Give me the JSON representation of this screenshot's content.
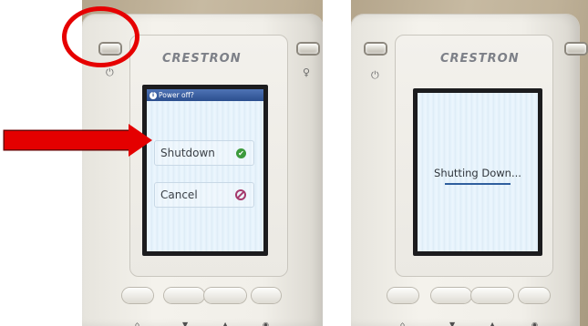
{
  "left_panel": {
    "brand": "CRESTRON",
    "dialog_title": "Power off?",
    "option_shutdown": "Shutdown",
    "option_cancel": "Cancel"
  },
  "right_panel": {
    "brand": "CRESTRON",
    "status_text": "Shutting Down..."
  },
  "icons": [
    "power-icon",
    "lightbulb-icon",
    "home-icon",
    "down-arrow-icon",
    "up-arrow-icon",
    "disc-icon",
    "check-icon",
    "cancel-icon",
    "info-icon"
  ],
  "colors": {
    "annotation_red": "#e60000",
    "dialog_title_bar": "#2c4f8e",
    "check_green": "#3c9a3c",
    "cancel_magenta": "#a63a6c",
    "progress_blue": "#2f5f9e"
  }
}
